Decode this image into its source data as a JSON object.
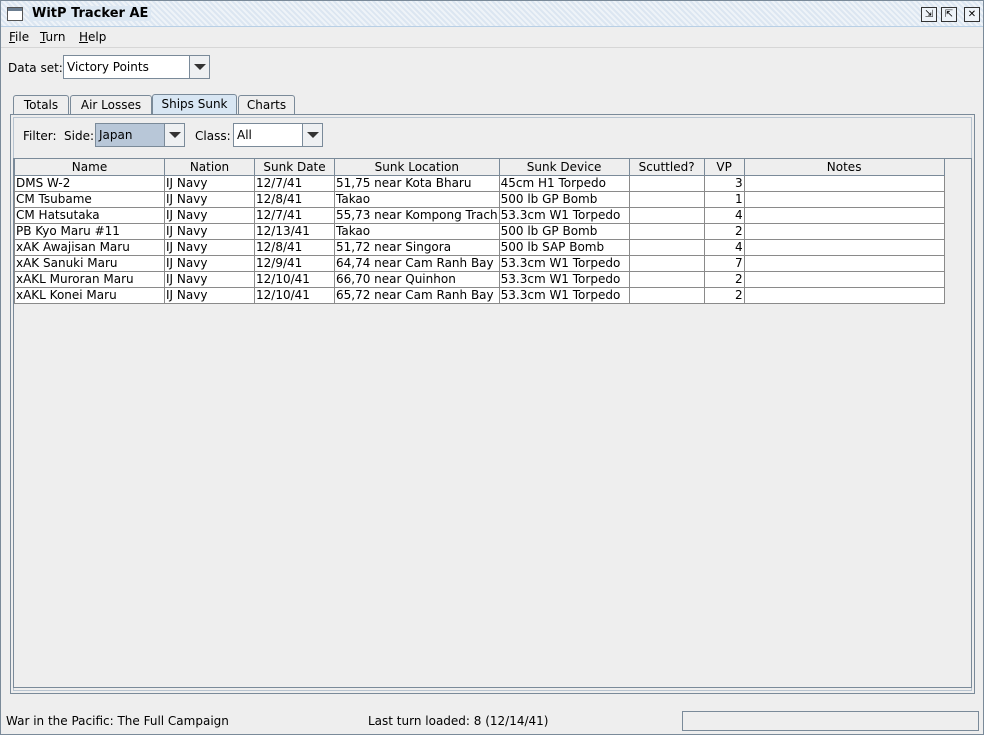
{
  "window": {
    "title": "WitP Tracker AE",
    "controls": {
      "minimize": "⇲",
      "maximize": "⇱",
      "close": "✕"
    }
  },
  "menu": [
    {
      "label": "File",
      "mnemonic": "F",
      "rest": "ile"
    },
    {
      "label": "Turn",
      "mnemonic": "T",
      "rest": "urn"
    },
    {
      "label": "Help",
      "mnemonic": "H",
      "rest": "elp"
    }
  ],
  "dataset": {
    "label": "Data set:",
    "value": "Victory Points"
  },
  "tabs": [
    {
      "label": "Totals",
      "active": false
    },
    {
      "label": "Air Losses",
      "active": false
    },
    {
      "label": "Ships Sunk",
      "active": true
    },
    {
      "label": "Charts",
      "active": false
    }
  ],
  "filter": {
    "label": "Filter:",
    "side_label": "Side:",
    "side_value": "Japan",
    "class_label": "Class:",
    "class_value": "All"
  },
  "table": {
    "columns": [
      "Name",
      "Nation",
      "Sunk Date",
      "Sunk Location",
      "Sunk Device",
      "Scuttled?",
      "VP",
      "Notes"
    ],
    "rows": [
      [
        "DMS W-2",
        "IJ Navy",
        "12/7/41",
        "51,75 near Kota Bharu",
        "45cm H1 Torpedo",
        "",
        "3",
        ""
      ],
      [
        "CM Tsubame",
        "IJ Navy",
        "12/8/41",
        "Takao",
        "500 lb GP Bomb",
        "",
        "1",
        ""
      ],
      [
        "CM Hatsutaka",
        "IJ Navy",
        "12/7/41",
        "55,73 near Kompong Trach",
        "53.3cm W1 Torpedo",
        "",
        "4",
        ""
      ],
      [
        "PB Kyo Maru #11",
        "IJ Navy",
        "12/13/41",
        "Takao",
        "500 lb GP Bomb",
        "",
        "2",
        ""
      ],
      [
        "xAK Awajisan Maru",
        "IJ Navy",
        "12/8/41",
        "51,72 near Singora",
        "500 lb SAP Bomb",
        "",
        "4",
        ""
      ],
      [
        "xAK Sanuki Maru",
        "IJ Navy",
        "12/9/41",
        "64,74 near Cam Ranh Bay",
        "53.3cm W1 Torpedo",
        "",
        "7",
        ""
      ],
      [
        "xAKL Muroran Maru",
        "IJ Navy",
        "12/10/41",
        "66,70 near Quinhon",
        "53.3cm W1 Torpedo",
        "",
        "2",
        ""
      ],
      [
        "xAKL Konei Maru",
        "IJ Navy",
        "12/10/41",
        "65,72 near Cam Ranh Bay",
        "53.3cm W1 Torpedo",
        "",
        "2",
        ""
      ]
    ]
  },
  "status": {
    "campaign": "War in the Pacific: The Full Campaign",
    "last_turn": "Last turn loaded: 8 (12/14/41)",
    "field": ""
  }
}
